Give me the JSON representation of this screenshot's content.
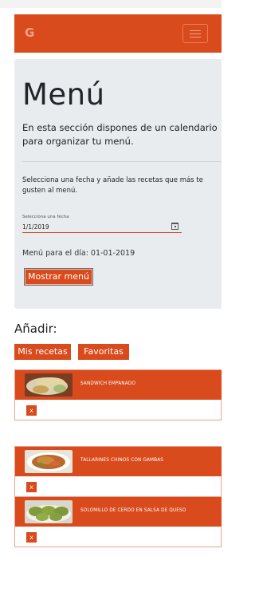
{
  "navbar": {
    "brand": "G"
  },
  "jumbotron": {
    "title": "Menú",
    "lead": "En esta sección dispones de un calendario para organizar tu menú.",
    "info": "Selecciona una fecha y añade las recetas que más te gusten al menú.",
    "date_label": "Selecciona una fecha",
    "date_value": "1/1/2019",
    "menu_for": "Menú para el día: 01-01-2019",
    "show_button": "Mostrar menú"
  },
  "add": {
    "heading": "Añadir:",
    "buttons": [
      "Mis recetas",
      "Favoritas"
    ]
  },
  "recipes": [
    {
      "name": "SANDWICH EMPANADO",
      "remove": "x"
    },
    {
      "name": "TALLARINES CHINOS CON GAMBAS",
      "remove": "x"
    },
    {
      "name": "SOLOMILLO DE CERDO EN SALSA DE QUESO",
      "remove": "x"
    }
  ],
  "colors": {
    "primary": "#d94a1c",
    "jumbotron_bg": "#e9ecef"
  }
}
